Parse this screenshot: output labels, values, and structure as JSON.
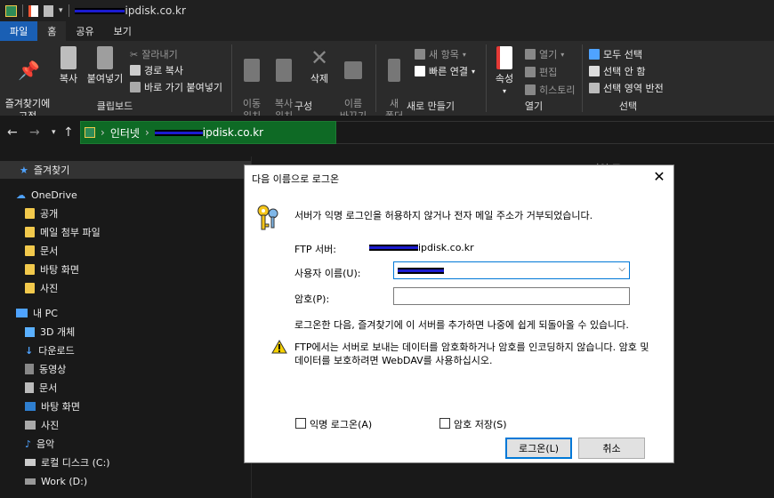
{
  "titlebar": {
    "title_suffix": "ipdisk.co.kr"
  },
  "tabs": [
    {
      "label": "파일"
    },
    {
      "label": "홈"
    },
    {
      "label": "공유"
    },
    {
      "label": "보기"
    }
  ],
  "ribbon": {
    "clipboard": {
      "pin": "즐겨찾기에\n고정",
      "copy": "복사",
      "paste": "붙여넣기",
      "cut": "잘라내기",
      "copy_path": "경로 복사",
      "paste_shortcut": "바로 가기 붙여넣기",
      "group": "클립보드"
    },
    "organize": {
      "move": "이동\n위치",
      "copyto": "복사\n위치",
      "delete": "삭제",
      "rename": "이름\n바꾸기",
      "group": "구성"
    },
    "new": {
      "folder": "새\n폴더",
      "new_item": "새 항목",
      "easy_access": "빠른 연결",
      "group": "새로 만들기"
    },
    "open": {
      "props": "속성",
      "open": "열기",
      "edit": "편집",
      "history": "히스토리",
      "group": "열기"
    },
    "select": {
      "all": "모두 선택",
      "none": "선택 안 함",
      "invert": "선택 영역 반전",
      "group": "선택"
    }
  },
  "address": {
    "root": "인터넷",
    "suffix": "ipdisk.co.kr"
  },
  "nav": {
    "favorites": "즐겨찾기",
    "onedrive": "OneDrive",
    "onedrive_items": [
      "공개",
      "메일 첨부 파일",
      "문서",
      "바탕 화면",
      "사진"
    ],
    "thispc": "내 PC",
    "pc_items": [
      "3D 개체",
      "다운로드",
      "동영상",
      "문서",
      "바탕 화면",
      "사진",
      "음악",
      "로컬 디스크 (C:)",
      "Work (D:)"
    ]
  },
  "content": {
    "col_header": "자연 조"
  },
  "dialog": {
    "title": "다음 이름으로 로그온",
    "close": "✕",
    "message": "서버가 익명 로그인을 허용하지 않거나 전자 메일 주소가 거부되었습니다.",
    "ftp_label": "FTP 서버:",
    "ftp_suffix": "ipdisk.co.kr",
    "user_label": "사용자 이름(U):",
    "pass_label": "암호(P):",
    "info": "로그온한 다음, 즐겨찾기에 이 서버를 추가하면 나중에 쉽게 되돌아올 수 있습니다.",
    "warn_line1": "FTP에서는 서버로 보내는 데이터를 암호화하거나 암호를 인코딩하지 않습니다. 암호 및",
    "warn_line2": "데이터를 보호하려면 WebDAV를 사용하십시오.",
    "anon_label": "익명 로그온(A)",
    "save_label": "암호 저장(S)",
    "logon_btn": "로그온(L)",
    "cancel_btn": "취소"
  }
}
